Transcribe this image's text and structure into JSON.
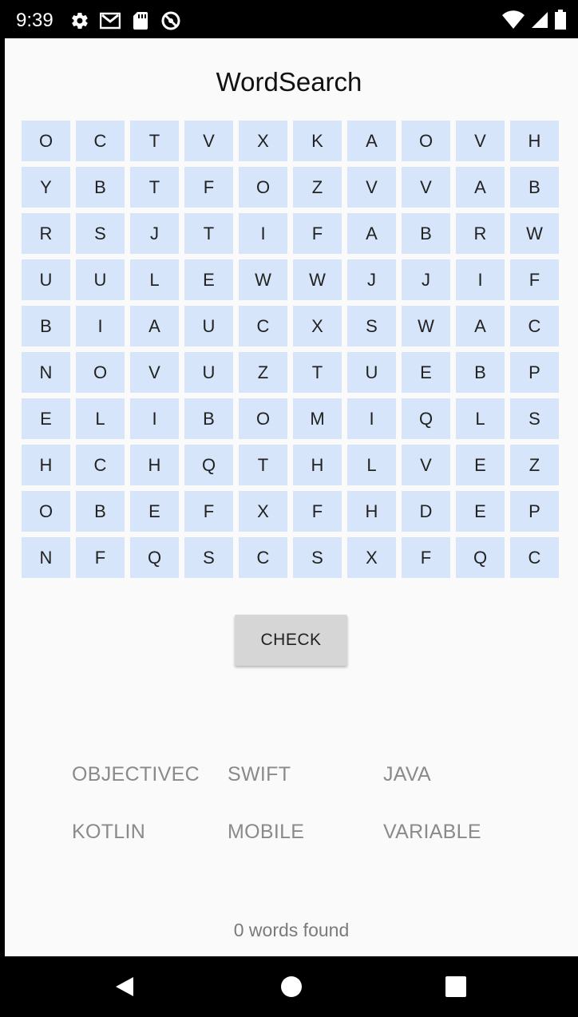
{
  "status_bar": {
    "time": "9:39",
    "left_icons": [
      "gear-icon",
      "gmail-icon",
      "sd-card-icon",
      "no-sync-icon"
    ],
    "right_icons": [
      "wifi-icon",
      "signal-icon",
      "battery-icon"
    ]
  },
  "app": {
    "title": "WordSearch",
    "grid": [
      [
        "O",
        "C",
        "T",
        "V",
        "X",
        "K",
        "A",
        "O",
        "V",
        "H"
      ],
      [
        "Y",
        "B",
        "T",
        "F",
        "O",
        "Z",
        "V",
        "V",
        "A",
        "B"
      ],
      [
        "R",
        "S",
        "J",
        "T",
        "I",
        "F",
        "A",
        "B",
        "R",
        "W"
      ],
      [
        "U",
        "U",
        "L",
        "E",
        "W",
        "W",
        "J",
        "J",
        "I",
        "F"
      ],
      [
        "B",
        "I",
        "A",
        "U",
        "C",
        "X",
        "S",
        "W",
        "A",
        "C"
      ],
      [
        "N",
        "O",
        "V",
        "U",
        "Z",
        "T",
        "U",
        "E",
        "B",
        "P"
      ],
      [
        "E",
        "L",
        "I",
        "B",
        "O",
        "M",
        "I",
        "Q",
        "L",
        "S"
      ],
      [
        "H",
        "C",
        "H",
        "Q",
        "T",
        "H",
        "L",
        "V",
        "E",
        "Z"
      ],
      [
        "O",
        "B",
        "E",
        "F",
        "X",
        "F",
        "H",
        "D",
        "E",
        "P"
      ],
      [
        "N",
        "F",
        "Q",
        "S",
        "C",
        "S",
        "X",
        "F",
        "Q",
        "C"
      ]
    ],
    "check_label": "CHECK",
    "words": [
      "OBJECTIVEC",
      "SWIFT",
      "JAVA",
      "KOTLIN",
      "MOBILE",
      "VARIABLE"
    ],
    "found_text": "0 words found"
  },
  "colors": {
    "cell_bg": "#d6e5f9",
    "app_bg": "#fafafa",
    "button_bg": "#d6d6d6",
    "word_color": "#8a8a8a"
  },
  "nav_bar": {
    "buttons": [
      "back-icon",
      "home-icon",
      "recents-icon"
    ]
  }
}
